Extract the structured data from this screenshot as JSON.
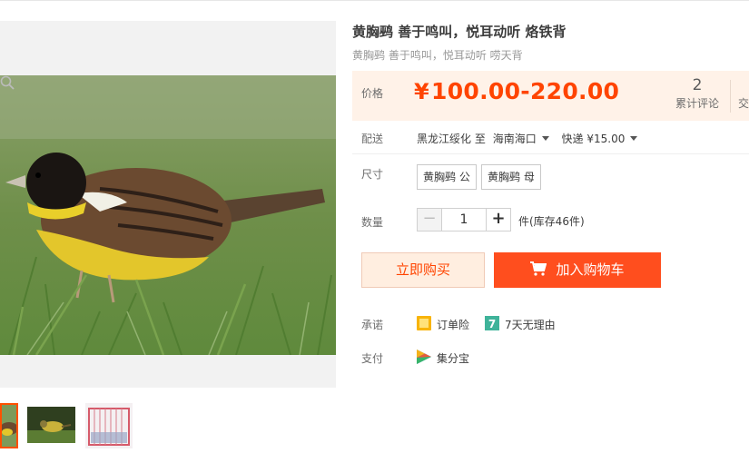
{
  "product": {
    "title": "黄胸鹀 善于鸣叫，悦耳动听 烙铁背",
    "subtitle": "黄胸鹀 善于鸣叫，悦耳动听 唠天背"
  },
  "price": {
    "label": "价格",
    "currency": "¥",
    "value": "100.00-220.00",
    "reviews_count": "2",
    "reviews_label": "累计评论",
    "deals_label_partial": "交"
  },
  "shipping": {
    "label": "配送",
    "from": "黑龙江绥化",
    "to_word": "至",
    "destination": "海南海口",
    "method": "快递 ¥15.00"
  },
  "size": {
    "label": "尺寸",
    "options": [
      "黄胸鹀 公",
      "黄胸鹀 母"
    ]
  },
  "quantity": {
    "label": "数量",
    "minus": "−",
    "value": "1",
    "plus": "+",
    "stock_text": "件(库存46件)"
  },
  "actions": {
    "buy_now": "立即购买",
    "add_to_cart": "加入购物车"
  },
  "promise": {
    "label": "承诺",
    "items": [
      "订单险",
      "7天无理由"
    ],
    "seven_day_badge": "7"
  },
  "payment": {
    "label": "支付",
    "method": "集分宝"
  },
  "colors": {
    "accent": "#ff4400",
    "cart_button": "#ff4e1e",
    "price_bg": "#fff2e8"
  },
  "icons": [
    "zoom-icon",
    "cart-icon",
    "insurance-icon",
    "seven-day-icon",
    "jifenbao-icon",
    "caret-down-icon"
  ]
}
